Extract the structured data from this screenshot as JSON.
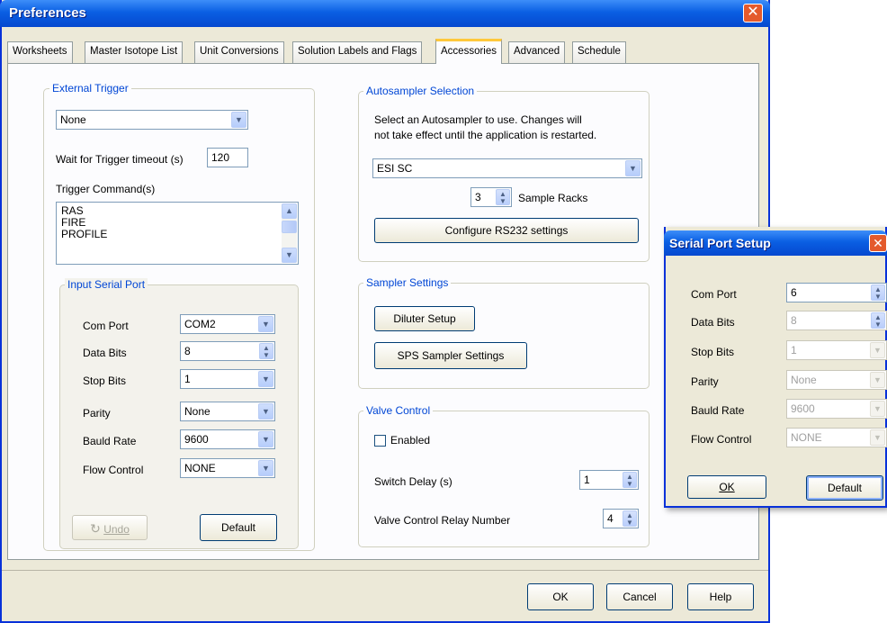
{
  "window": {
    "title": "Preferences",
    "close_glyph": "✕"
  },
  "tabs": [
    {
      "label": "Worksheets"
    },
    {
      "label": "Master Isotope List"
    },
    {
      "label": "Unit Conversions"
    },
    {
      "label": "Solution Labels and Flags"
    },
    {
      "label": "Accessories"
    },
    {
      "label": "Advanced"
    },
    {
      "label": "Schedule"
    }
  ],
  "external_trigger": {
    "legend": "External Trigger",
    "mode_value": "None",
    "timeout_label": "Wait for Trigger timeout (s)",
    "timeout_value": "120",
    "commands_label": "Trigger Command(s)",
    "commands": [
      "RAS",
      "FIRE",
      "PROFILE"
    ]
  },
  "input_serial_port": {
    "legend": "Input Serial Port",
    "rows": [
      {
        "label": "Com Port",
        "value": "COM2",
        "control": "dropdown"
      },
      {
        "label": "Data Bits",
        "value": "8",
        "control": "spin"
      },
      {
        "label": "Stop Bits",
        "value": "1",
        "control": "dropdown"
      },
      {
        "label": "Parity",
        "value": "None",
        "control": "dropdown"
      },
      {
        "label": "Bauld Rate",
        "value": "9600",
        "control": "dropdown"
      },
      {
        "label": "Flow Control",
        "value": "NONE",
        "control": "dropdown"
      }
    ],
    "undo_label": "Undo",
    "default_label": "Default"
  },
  "autosampler": {
    "legend": "Autosampler Selection",
    "description_line1": "Select an Autosampler to use.  Changes will",
    "description_line2": "not take effect until the application is restarted.",
    "selected": "ESI SC",
    "racks_value": "3",
    "racks_label": "Sample Racks",
    "configure_label": "Configure RS232 settings"
  },
  "sampler_settings": {
    "legend": "Sampler Settings",
    "diluter_label": "Diluter Setup",
    "sps_label": "SPS Sampler Settings"
  },
  "valve_control": {
    "legend": "Valve Control",
    "enabled_label": "Enabled",
    "enabled_checked": false,
    "switch_delay_label": "Switch Delay (s)",
    "switch_delay_value": "1",
    "relay_label": "Valve Control Relay Number",
    "relay_value": "4"
  },
  "footer": {
    "ok": "OK",
    "cancel": "Cancel",
    "help": "Help"
  },
  "serial_port_setup": {
    "title": "Serial Port Setup",
    "rows": [
      {
        "label": "Com Port",
        "value": "6",
        "control": "spin",
        "enabled": true
      },
      {
        "label": "Data Bits",
        "value": "8",
        "control": "spin",
        "enabled": false
      },
      {
        "label": "Stop Bits",
        "value": "1",
        "control": "dropdown",
        "enabled": false
      },
      {
        "label": "Parity",
        "value": "None",
        "control": "dropdown",
        "enabled": false
      },
      {
        "label": "Bauld Rate",
        "value": "9600",
        "control": "dropdown",
        "enabled": false
      },
      {
        "label": "Flow Control",
        "value": "NONE",
        "control": "dropdown",
        "enabled": false
      }
    ],
    "ok": "OK",
    "default": "Default"
  },
  "icons": {
    "dropdown": "chevron-down-icon",
    "spin": "spin-arrows-icon",
    "undo": "undo-icon",
    "close": "close-icon"
  },
  "colors": {
    "titlebar": "#0a5fe3",
    "group_label": "#0046d5",
    "active_tab_accent": "#ffc83c",
    "close_button": "#e45a2c"
  }
}
